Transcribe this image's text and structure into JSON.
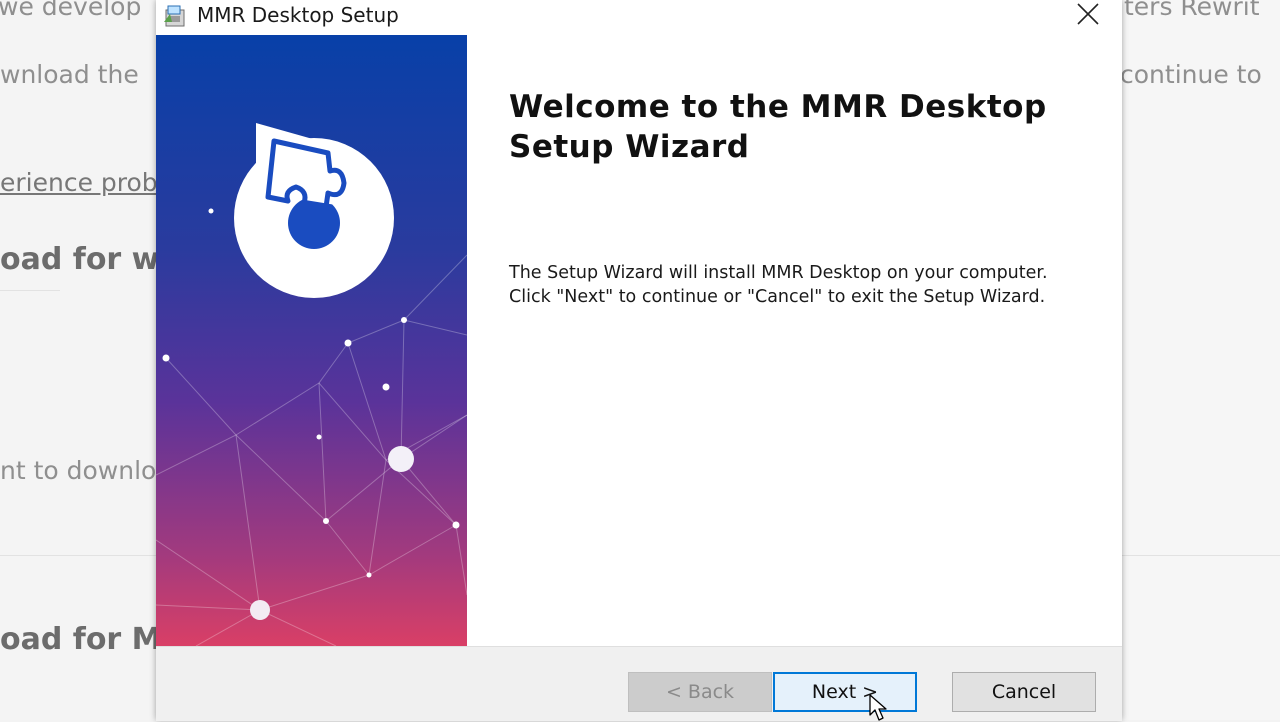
{
  "background_page": {
    "fragments": [
      "we develop",
      "wnload the",
      "erience prob",
      "oad for wi",
      "nt to downlo",
      "oad for M",
      "ters Rewrit",
      "continue to"
    ]
  },
  "window": {
    "title": "MMR Desktop Setup",
    "icon": "installer-icon",
    "close_icon": "close-icon"
  },
  "banner": {
    "gradient_top": "#0a3da8",
    "gradient_mid": "#5a2f9a",
    "gradient_bottom": "#cf3b6b",
    "logo_icon": "puzzle-logo-icon"
  },
  "content": {
    "heading": "Welcome to the MMR Desktop Setup Wizard",
    "line1": "The Setup Wizard will install MMR Desktop on your computer.",
    "line2": "Click \"Next\" to continue or \"Cancel\" to exit the Setup Wizard."
  },
  "buttons": {
    "back": "< Back",
    "next": "Next >",
    "cancel": "Cancel"
  },
  "colors": {
    "accent": "#0078d7"
  }
}
